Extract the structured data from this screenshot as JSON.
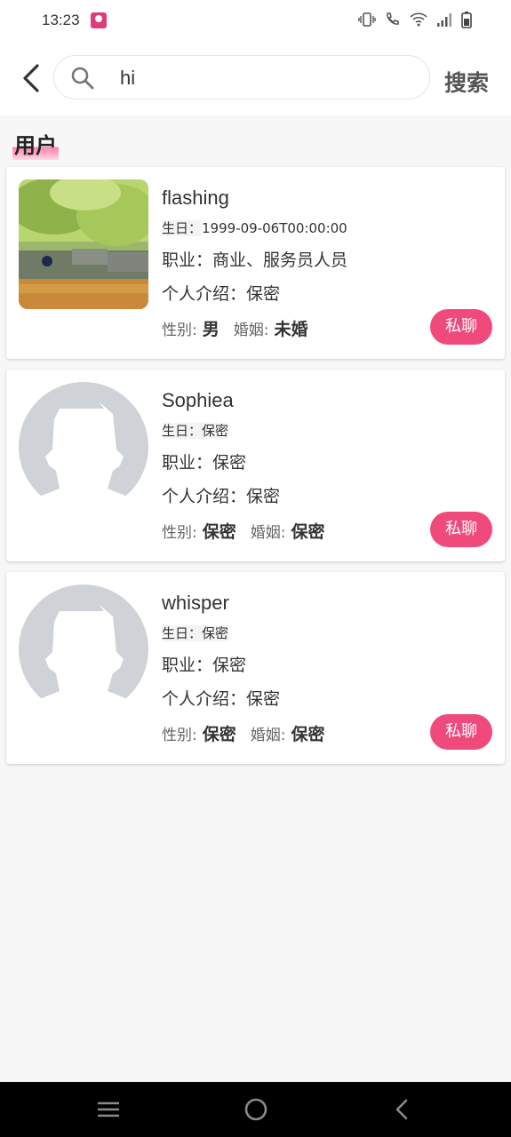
{
  "status": {
    "time": "13:23"
  },
  "search": {
    "value": "hi",
    "button_label": "搜索"
  },
  "section": {
    "title": "用户"
  },
  "users": [
    {
      "name": "flashing",
      "birthday_label": "生日：",
      "birthday": "1999-09-06T00:00:00",
      "job_label": "职业：",
      "job": "商业、服务员人员",
      "intro_label": "个人介绍：",
      "intro": "保密",
      "gender_label": "性别:",
      "gender": "男",
      "marriage_label": "婚姻:",
      "marriage": "未婚",
      "chat_label": "私聊"
    },
    {
      "name": "Sophiea",
      "birthday_label": "生日：",
      "birthday": "保密",
      "job_label": "职业：",
      "job": "保密",
      "intro_label": "个人介绍：",
      "intro": "保密",
      "gender_label": "性别:",
      "gender": "保密",
      "marriage_label": "婚姻:",
      "marriage": "保密",
      "chat_label": "私聊"
    },
    {
      "name": "whisper",
      "birthday_label": "生日：",
      "birthday": "保密",
      "job_label": "职业：",
      "job": "保密",
      "intro_label": "个人介绍：",
      "intro": "保密",
      "gender_label": "性别:",
      "gender": "保密",
      "marriage_label": "婚姻:",
      "marriage": "保密",
      "chat_label": "私聊"
    }
  ],
  "colors": {
    "accent": "#f04a7c",
    "avatar_placeholder": "#cfd3d8"
  }
}
